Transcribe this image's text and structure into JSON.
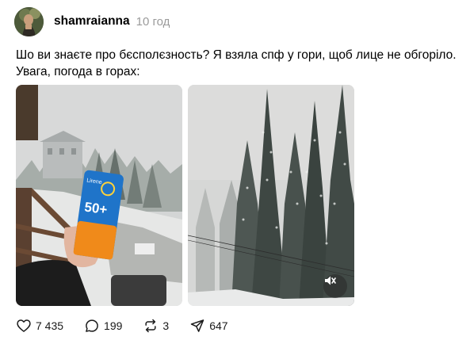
{
  "post": {
    "username": "shamraianna",
    "time": "10 год",
    "text_line1": "Шо ви знаєте про бєсполєзность? Я взяла спф у гори, щоб лице не обгоріло.",
    "text_line2": "Увага, погода в горах:"
  },
  "media": {
    "sunscreen": {
      "brand": "Lirene",
      "spf": "50+"
    }
  },
  "actions": {
    "likes": "7 435",
    "comments": "199",
    "reposts": "3",
    "shares": "647"
  },
  "icons": {
    "like": "heart-icon",
    "comment": "comment-bubble-icon",
    "repost": "repost-icon",
    "share": "send-icon",
    "mute": "speaker-muted-icon"
  }
}
